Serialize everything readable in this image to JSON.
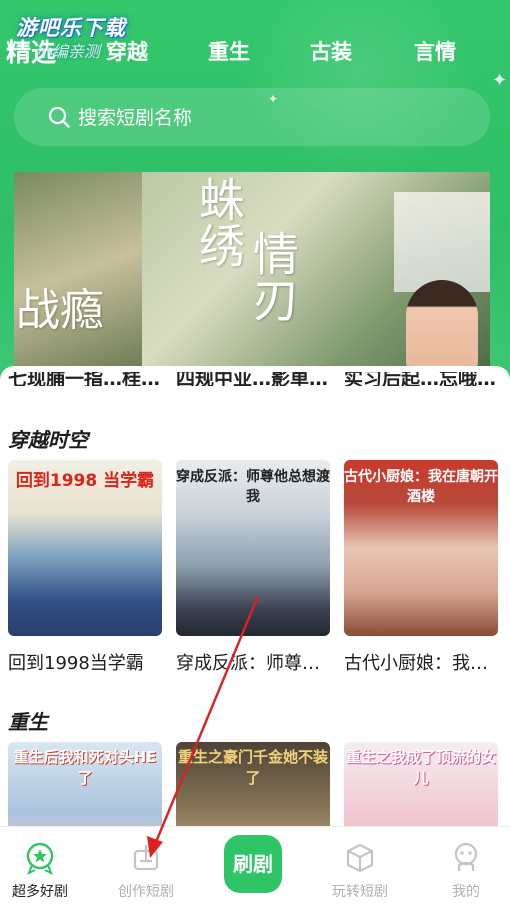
{
  "watermark": {
    "line1": "游吧乐下载",
    "line2": "小编亲测"
  },
  "tabs": [
    {
      "label": "精选",
      "active": true
    },
    {
      "label": "穿越",
      "active": false
    },
    {
      "label": "重生",
      "active": false
    },
    {
      "label": "古装",
      "active": false
    },
    {
      "label": "言情",
      "active": false
    }
  ],
  "search": {
    "placeholder": "搜索短剧名称"
  },
  "banner": {
    "left_text": "战瘾",
    "main_text_1": "蛛绣",
    "main_text_2": "情刃"
  },
  "cut_titles": [
    "七现脯一指…桂…",
    "四规中业…影单…",
    "实习后起…忘哦…"
  ],
  "sections": [
    {
      "title": "穿越时空",
      "items": [
        {
          "poster_caption": "回到1998 当学霸",
          "title": "回到1998当学霸"
        },
        {
          "poster_caption": "穿成反派：师尊他总想渡我",
          "title": "穿成反派：师尊…"
        },
        {
          "poster_caption": "古代小厨娘：我在唐朝开酒楼",
          "title": "古代小厨娘：我…"
        }
      ]
    },
    {
      "title": "重生",
      "items": [
        {
          "poster_caption": "重生后我和死对头HE了",
          "title": ""
        },
        {
          "poster_caption": "重生之豪门千金她不装了",
          "title": ""
        },
        {
          "poster_caption": "重生之我成了顶流的女儿",
          "title": ""
        }
      ]
    }
  ],
  "nav": {
    "items": [
      {
        "label": "超多好剧",
        "icon": "star-badge-icon",
        "active": true
      },
      {
        "label": "创作短剧",
        "icon": "create-icon",
        "active": false
      },
      {
        "label": "刷剧",
        "icon": "center-play",
        "active": false
      },
      {
        "label": "玩转短剧",
        "icon": "cube-icon",
        "active": false
      },
      {
        "label": "我的",
        "icon": "profile-icon",
        "active": false
      }
    ]
  },
  "colors": {
    "brand_green": "#2fc566",
    "header_green": "#34c76c",
    "annotation_arrow": "#e02020"
  }
}
